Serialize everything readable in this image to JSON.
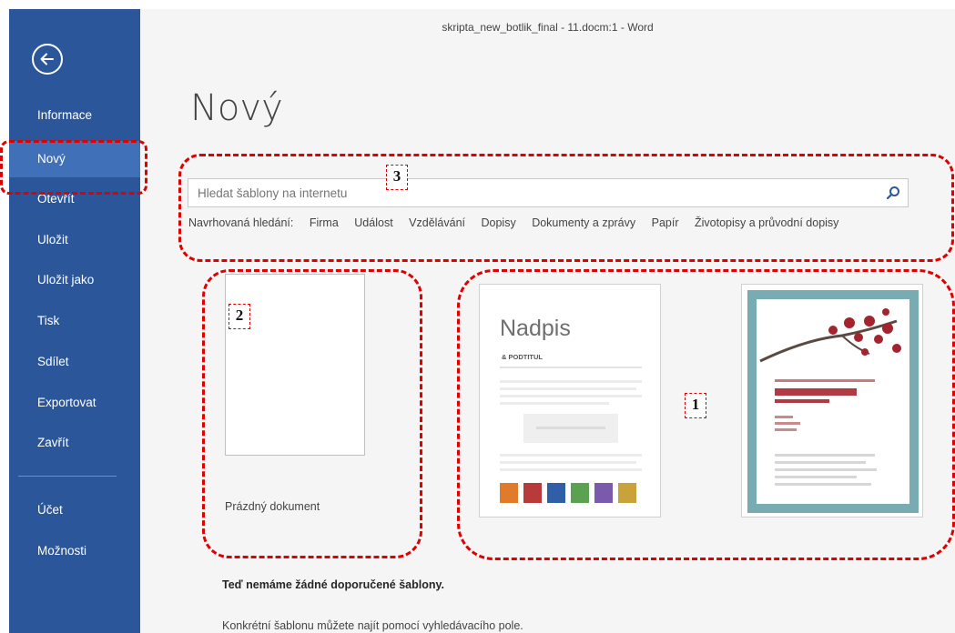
{
  "window": {
    "title": "skripta_new_botlik_final - 11.docm:1 - Word"
  },
  "sidebar": {
    "items": [
      {
        "label": "Informace"
      },
      {
        "label": "Nový"
      },
      {
        "label": "Otevřít"
      },
      {
        "label": "Uložit"
      },
      {
        "label": "Uložit jako"
      },
      {
        "label": "Tisk"
      },
      {
        "label": "Sdílet"
      },
      {
        "label": "Exportovat"
      },
      {
        "label": "Zavřít"
      },
      {
        "label": "Účet"
      },
      {
        "label": "Možnosti"
      }
    ],
    "active_item": "Nový"
  },
  "main": {
    "title": "Nový",
    "search": {
      "placeholder": "Hledat šablony na internetu"
    },
    "suggested": {
      "label": "Navrhovaná hledání:",
      "items": [
        "Firma",
        "Událost",
        "Vzdělávání",
        "Dopisy",
        "Dokumenty a zprávy",
        "Papír",
        "Životopisy a průvodní dopisy"
      ]
    },
    "templates": {
      "blank_label": "Prázdný dokument",
      "template_a": {
        "heading": "Nadpis",
        "subheading": "& PODTITUL"
      },
      "template_b": {}
    },
    "info": {
      "title": "Teď nemáme žádné doporučené šablony.",
      "text": "Konkrétní šablonu můžete najít pomocí vyhledávacího pole."
    }
  },
  "annotations": {
    "labels": [
      "3",
      "2",
      "1"
    ]
  },
  "colors": {
    "sidebar": "#2b579a",
    "sidebar_active": "#3f70b8",
    "annotation": "#e00000",
    "swatches": [
      "#e07b2c",
      "#b93a3a",
      "#2f5fa7",
      "#5aa252",
      "#7a5bab",
      "#c9a23b"
    ],
    "frame": "#79abb3",
    "flower": "#a3242f"
  }
}
